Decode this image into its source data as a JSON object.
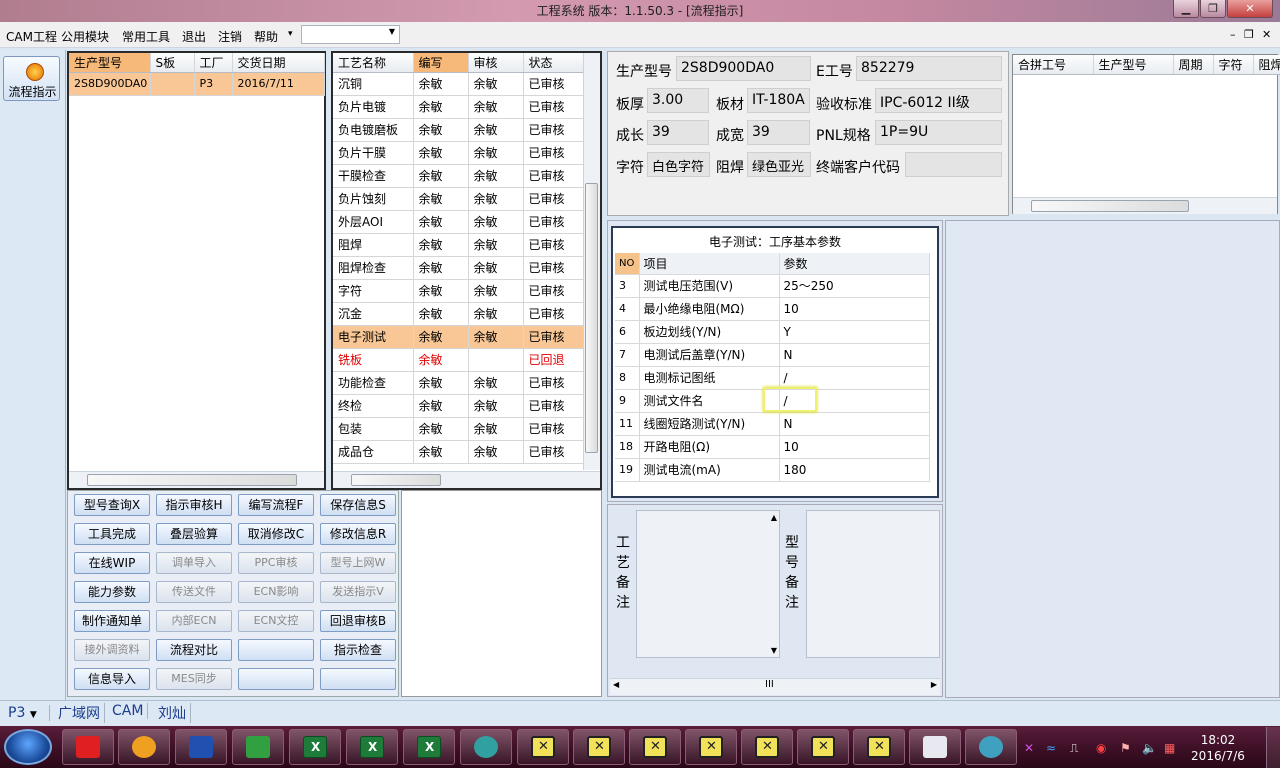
{
  "window": {
    "title": "工程系统    版本：1.1.50.3 - [流程指示]"
  },
  "menu": {
    "items": [
      "CAM工程",
      "公用模块",
      "常用工具",
      "退出",
      "注销",
      "帮助"
    ],
    "help_arrow": "▾",
    "combo_value": ""
  },
  "launcher": {
    "flow_label": "流程指示"
  },
  "orders": {
    "headers": [
      "生产型号",
      "S板",
      "工厂",
      "交货日期"
    ],
    "rows": [
      [
        "2S8D900DA0",
        "",
        "P3",
        "2016/7/11"
      ]
    ]
  },
  "process": {
    "headers": [
      "工艺名称",
      "编写",
      "审核",
      "状态"
    ],
    "rows": [
      [
        "沉铜",
        "余敏",
        "余敏",
        "已审核"
      ],
      [
        "负片电镀",
        "余敏",
        "余敏",
        "已审核"
      ],
      [
        "负电镀磨板",
        "余敏",
        "余敏",
        "已审核"
      ],
      [
        "负片干膜",
        "余敏",
        "余敏",
        "已审核"
      ],
      [
        "干膜检查",
        "余敏",
        "余敏",
        "已审核"
      ],
      [
        "负片蚀刻",
        "余敏",
        "余敏",
        "已审核"
      ],
      [
        "外层AOI",
        "余敏",
        "余敏",
        "已审核"
      ],
      [
        "阻焊",
        "余敏",
        "余敏",
        "已审核"
      ],
      [
        "阻焊检查",
        "余敏",
        "余敏",
        "已审核"
      ],
      [
        "字符",
        "余敏",
        "余敏",
        "已审核"
      ],
      [
        "沉金",
        "余敏",
        "余敏",
        "已审核"
      ],
      [
        "电子测试",
        "余敏",
        "余敏",
        "已审核"
      ],
      [
        "铣板",
        "余敏",
        "",
        "已回退"
      ],
      [
        "功能检查",
        "余敏",
        "余敏",
        "已审核"
      ],
      [
        "终检",
        "余敏",
        "余敏",
        "已审核"
      ],
      [
        "包装",
        "余敏",
        "余敏",
        "已审核"
      ],
      [
        "成品仓",
        "余敏",
        "余敏",
        "已审核"
      ]
    ],
    "selected": 11,
    "rejected": 12
  },
  "buttons": [
    [
      "型号查询X",
      "指示审核H",
      "编写流程F",
      "保存信息S"
    ],
    [
      "工具完成",
      "叠层验算",
      "取消修改C",
      "修改信息R"
    ],
    [
      "在线WIP",
      "调单导入",
      "PPC审核",
      "型号上网W"
    ],
    [
      "能力参数",
      "传送文件",
      "ECN影响",
      "发送指示V"
    ],
    [
      "制作通知单",
      "内部ECN",
      "ECN文控",
      "回退审核B"
    ],
    [
      "接外调资料",
      "流程对比",
      "",
      "指示检查"
    ],
    [
      "信息导入",
      "MES同步",
      "",
      ""
    ]
  ],
  "info": {
    "model_label": "生产型号",
    "model": "2S8D900DA0",
    "eno_label": "E工号",
    "eno": "852279",
    "thick_label": "板厚",
    "thick": "3.00",
    "mat_label": "板材",
    "mat": "IT-180A",
    "std_label": "验收标准",
    "std": "IPC-6012 II级",
    "len_label": "成长",
    "len": "39",
    "wid_label": "成宽",
    "wid": "39",
    "pnl_label": "PNL规格",
    "pnl": "1P=9U",
    "char_label": "字符",
    "char": "白色字符",
    "mask_label": "阻焊",
    "mask": "绿色亚光",
    "cust_label": "终端客户代码",
    "cust": ""
  },
  "merge": {
    "headers": [
      "合拼工号",
      "生产型号",
      "周期",
      "字符",
      "阻焊"
    ]
  },
  "params": {
    "title": "电子测试：工序基本参数",
    "headers": [
      "NO",
      "项目",
      "参数"
    ],
    "rows": [
      [
        "3",
        "测试电压范围(V)",
        "25～250"
      ],
      [
        "4",
        "最小绝缘电阻(MΩ)",
        "10"
      ],
      [
        "6",
        "板边划线(Y/N)",
        "Y"
      ],
      [
        "7",
        "电测试后盖章(Y/N)",
        "N"
      ],
      [
        "8",
        "电测标记图纸",
        "/"
      ],
      [
        "9",
        "测试文件名",
        "/"
      ],
      [
        "11",
        "线圈短路测试(Y/N)",
        "N"
      ],
      [
        "18",
        "开路电阻(Ω)",
        "10"
      ],
      [
        "19",
        "测试电流(mA)",
        "180"
      ]
    ]
  },
  "remarks": {
    "craft_label": "工艺备注",
    "model_label": "型号备注",
    "scroll_grip": "III"
  },
  "status": {
    "factory": "P3",
    "net": "广域网",
    "dept": "CAM",
    "user": "刘灿"
  },
  "taskbar": {
    "time": "18:02",
    "date": "2016/7/6"
  }
}
